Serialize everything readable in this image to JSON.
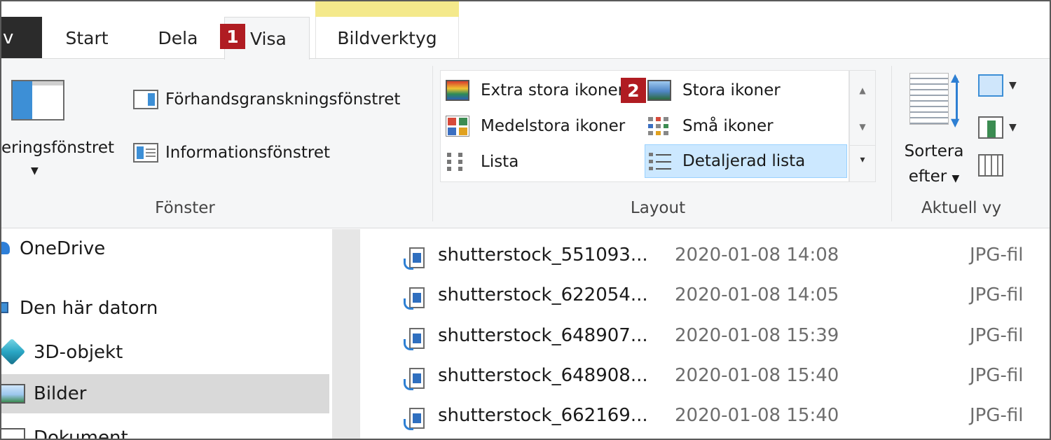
{
  "tabs": {
    "file_label": "v",
    "start": "Start",
    "share": "Dela",
    "view": "Visa",
    "picture_tools": "Bildverktyg"
  },
  "badges": {
    "one": "1",
    "two": "2"
  },
  "ribbon": {
    "window_group": {
      "nav_pane_label": "eringsfönstret",
      "preview_pane": "Förhandsgranskningsfönstret",
      "details_pane": "Informationsfönstret",
      "label": "Fönster"
    },
    "layout_group": {
      "items": [
        {
          "label": "Extra stora ikoner",
          "icon": "extra-large-icons-icon"
        },
        {
          "label": "Stora ikoner",
          "icon": "large-icons-icon"
        },
        {
          "label": "Medelstora ikoner",
          "icon": "medium-icons-icon"
        },
        {
          "label": "Små ikoner",
          "icon": "small-icons-icon"
        },
        {
          "label": "Lista",
          "icon": "list-icon"
        },
        {
          "label": "Detaljerad lista",
          "icon": "details-icon"
        }
      ],
      "selected": "Detaljerad lista",
      "label": "Layout"
    },
    "current_view_group": {
      "sort_label_1": "Sortera",
      "sort_label_2": "efter",
      "label": "Aktuell vy"
    }
  },
  "nav_pane": {
    "items": [
      {
        "label": "OneDrive",
        "icon": "onedrive-cloud-icon"
      },
      {
        "label": "Den här datorn",
        "icon": "this-pc-icon"
      },
      {
        "label": "3D-objekt",
        "icon": "3d-objects-icon"
      },
      {
        "label": "Bilder",
        "icon": "pictures-icon",
        "selected": true
      },
      {
        "label": "Dokument",
        "icon": "documents-icon"
      }
    ]
  },
  "files": [
    {
      "name": "shutterstock_551093...",
      "date": "2020-01-08 14:08",
      "type": "JPG-fil"
    },
    {
      "name": "shutterstock_622054...",
      "date": "2020-01-08 14:05",
      "type": "JPG-fil"
    },
    {
      "name": "shutterstock_648907...",
      "date": "2020-01-08 15:39",
      "type": "JPG-fil"
    },
    {
      "name": "shutterstock_648908...",
      "date": "2020-01-08 15:40",
      "type": "JPG-fil"
    },
    {
      "name": "shutterstock_662169...",
      "date": "2020-01-08 15:40",
      "type": "JPG-fil"
    }
  ],
  "colors": {
    "badge": "#b01c22",
    "selection": "#cce8ff",
    "context_tab": "#f4e98b",
    "accent": "#3d8fd6"
  }
}
